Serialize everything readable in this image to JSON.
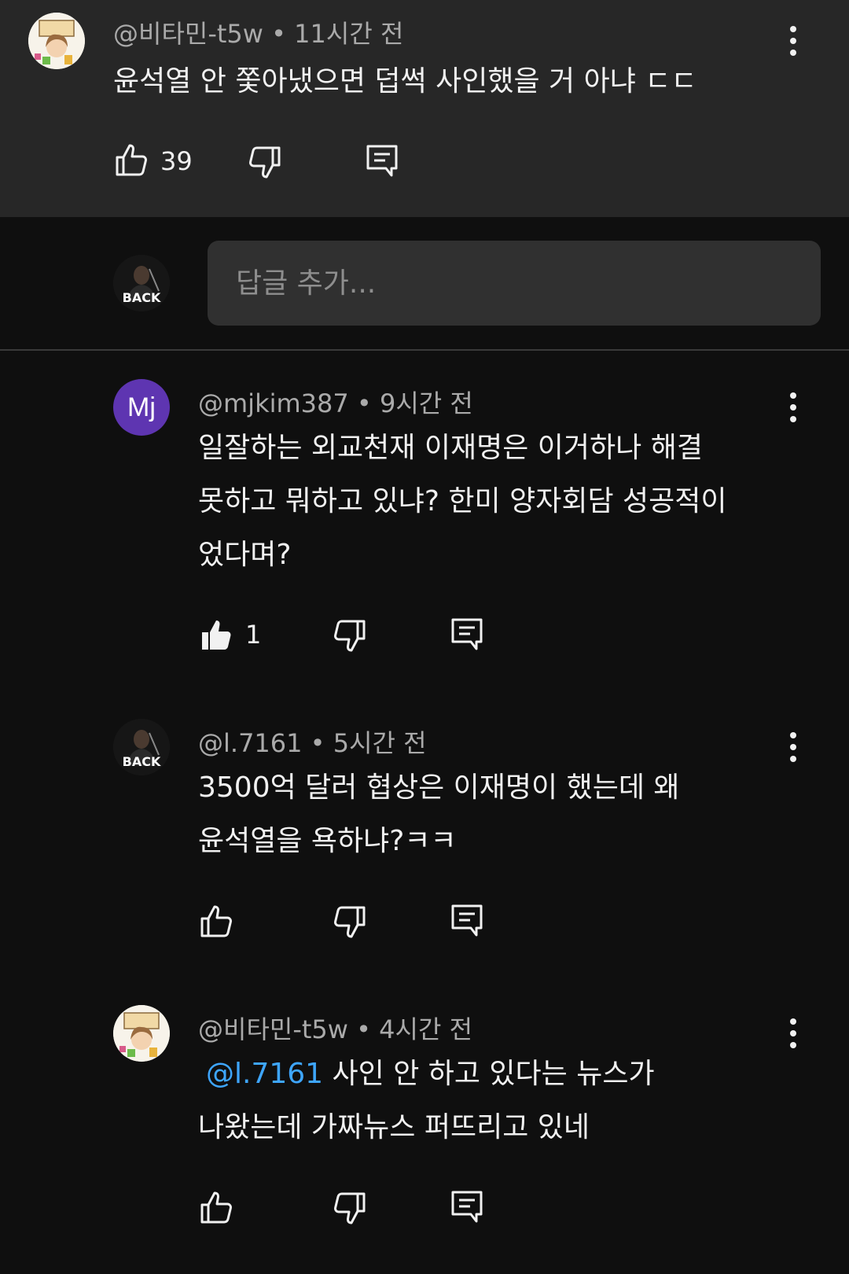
{
  "top_comment": {
    "handle": "@비타민-t5w",
    "time": "11시간 전",
    "text": "윤석열 안 쫓아냈으면 덥썩 사인했을 거 아냐 ㄷㄷ",
    "likes": "39"
  },
  "reply_input": {
    "placeholder": "답글 추가..."
  },
  "replies": [
    {
      "handle": "@mjkim387",
      "time": "9시간 전",
      "avatar_initials": "Mj",
      "avatar_color": "#5e35b1",
      "text_lines": [
        "일잘하는 외교천재 이재명은 이거하나 해결",
        "못하고 뭐하고 있냐? 한미 양자회담 성공적이",
        "었다며?"
      ],
      "likes": "1"
    },
    {
      "handle": "@l.7161",
      "time": "5시간 전",
      "avatar_text": "BACK",
      "text_lines": [
        "3500억 달러 협상은 이재명이 했는데 왜",
        "윤석열을 욕하냐?ㅋㅋ"
      ]
    },
    {
      "handle": "@비타민-t5w",
      "time": "4시간 전",
      "mention": "@l.7161",
      "text_line1_rest": " 사인 안 하고 있다는 뉴스가",
      "text_line2": "나왔는데 가짜뉴스 퍼뜨리고 있네"
    }
  ],
  "my_avatar_text": "BACK",
  "colors": {
    "background": "#0f0f0f",
    "highlight": "#272727",
    "mention": "#3ea6ff",
    "muted": "#aaaaaa"
  },
  "icons": [
    "thumbs-up-icon",
    "thumbs-down-icon",
    "reply-icon",
    "more-vert-icon"
  ]
}
